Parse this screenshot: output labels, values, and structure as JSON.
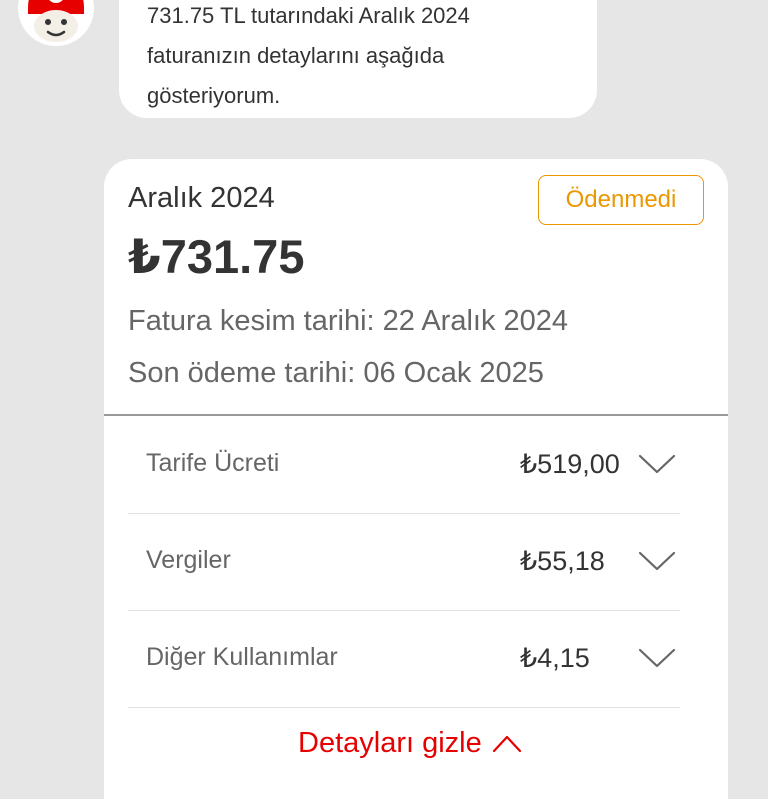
{
  "chat": {
    "message_lines": [
      "731.75 TL tutarındaki Aralık 2024",
      "faturanızın detaylarını aşağıda",
      "gösteriyorum."
    ]
  },
  "bill": {
    "period": "Aralık 2024",
    "status": "Ödenmedi",
    "amount": "₺731.75",
    "issue_date": "Fatura kesim tarihi: 22 Aralık 2024",
    "due_date": "Son ödeme tarihi: 06 Ocak 2025",
    "items": [
      {
        "label": "Tarife Ücreti",
        "value": "₺519,00"
      },
      {
        "label": "Vergiler",
        "value": "₺55,18"
      },
      {
        "label": "Diğer Kullanımlar",
        "value": "₺4,15"
      }
    ],
    "toggle_label": "Detayları gizle"
  },
  "icons": {
    "avatar": "robot-avatar-icon",
    "row_expand": "chevron-down-icon",
    "collapse": "chevron-up-icon"
  },
  "colors": {
    "accent_red": "#e60000",
    "unpaid_orange": "#eb9700"
  }
}
